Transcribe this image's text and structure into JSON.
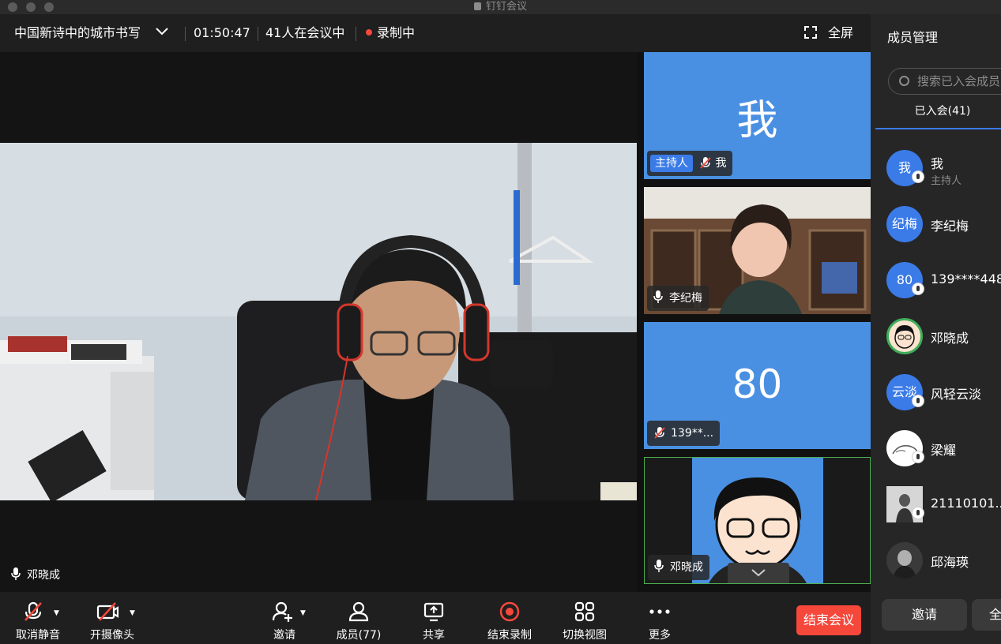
{
  "window": {
    "title": "钉钉会议"
  },
  "topbar": {
    "meeting_title": "中国新诗中的城市书写",
    "duration": "01:50:47",
    "attendees": "41人在会议中",
    "recording": "录制中",
    "fullscreen": "全屏"
  },
  "main_video": {
    "speaker_name": "邓晓成"
  },
  "tiles": [
    {
      "avatar_text": "我",
      "host_tag": "主持人",
      "name": "我"
    },
    {
      "name": "李纪梅"
    },
    {
      "avatar_text": "80",
      "name": "139**..."
    },
    {
      "name": "邓晓成"
    }
  ],
  "panel": {
    "title": "成员管理",
    "search_placeholder": "搜索已入会成员",
    "tab_joined": "已入会(41)",
    "members": [
      {
        "avatar_text": "我",
        "name": "我",
        "role": "主持人"
      },
      {
        "avatar_text": "纪梅",
        "name": "李纪梅"
      },
      {
        "avatar_text": "80",
        "name": "139****448"
      },
      {
        "avatar_text": "",
        "name": "邓晓成"
      },
      {
        "avatar_text": "云淡",
        "name": "风轻云淡"
      },
      {
        "avatar_text": "",
        "name": "梁耀"
      },
      {
        "avatar_text": "",
        "name": "21110101..."
      },
      {
        "avatar_text": "",
        "name": "邱海瑛"
      }
    ],
    "invite": "邀请",
    "all_partial": "全"
  },
  "toolbar": {
    "unmute": "取消静音",
    "camera": "开摄像头",
    "invite": "邀请",
    "members": "成员(77)",
    "share": "共享",
    "stop_record": "结束录制",
    "switch_view": "切换视图",
    "more": "更多",
    "end_meeting": "结束会议"
  },
  "colors": {
    "accent": "#3a7be8",
    "danger": "#f5483b",
    "tile_blue": "#4a90e2"
  }
}
